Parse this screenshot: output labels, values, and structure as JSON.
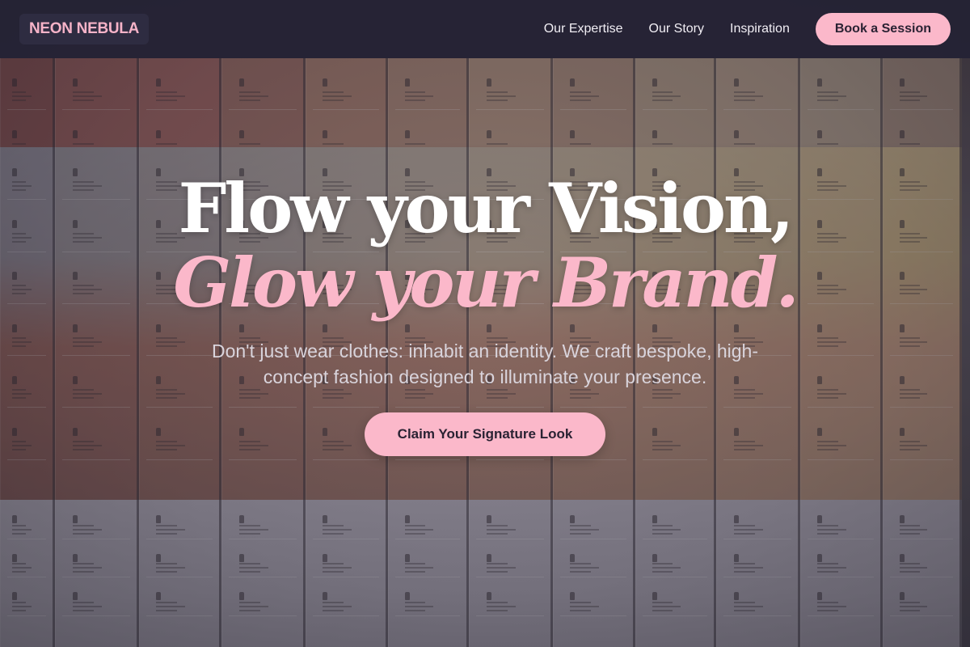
{
  "header": {
    "brand": "NEON NEBULA",
    "nav": [
      {
        "label": "Our Expertise"
      },
      {
        "label": "Our Story"
      },
      {
        "label": "Inspiration"
      }
    ],
    "cta_label": "Book a Session"
  },
  "hero": {
    "headline_line1": "Flow your Vision,",
    "headline_line2": "Glow your Brand.",
    "subtitle": "Don't just wear clothes: inhabit an identity. We craft bespoke, high-concept fashion designed to illuminate your presence.",
    "cta_label": "Claim Your Signature Look"
  },
  "colors": {
    "accent_pink": "#fbb8ca",
    "nav_bg": "#24223a",
    "brand_text": "#f6b3c8"
  }
}
